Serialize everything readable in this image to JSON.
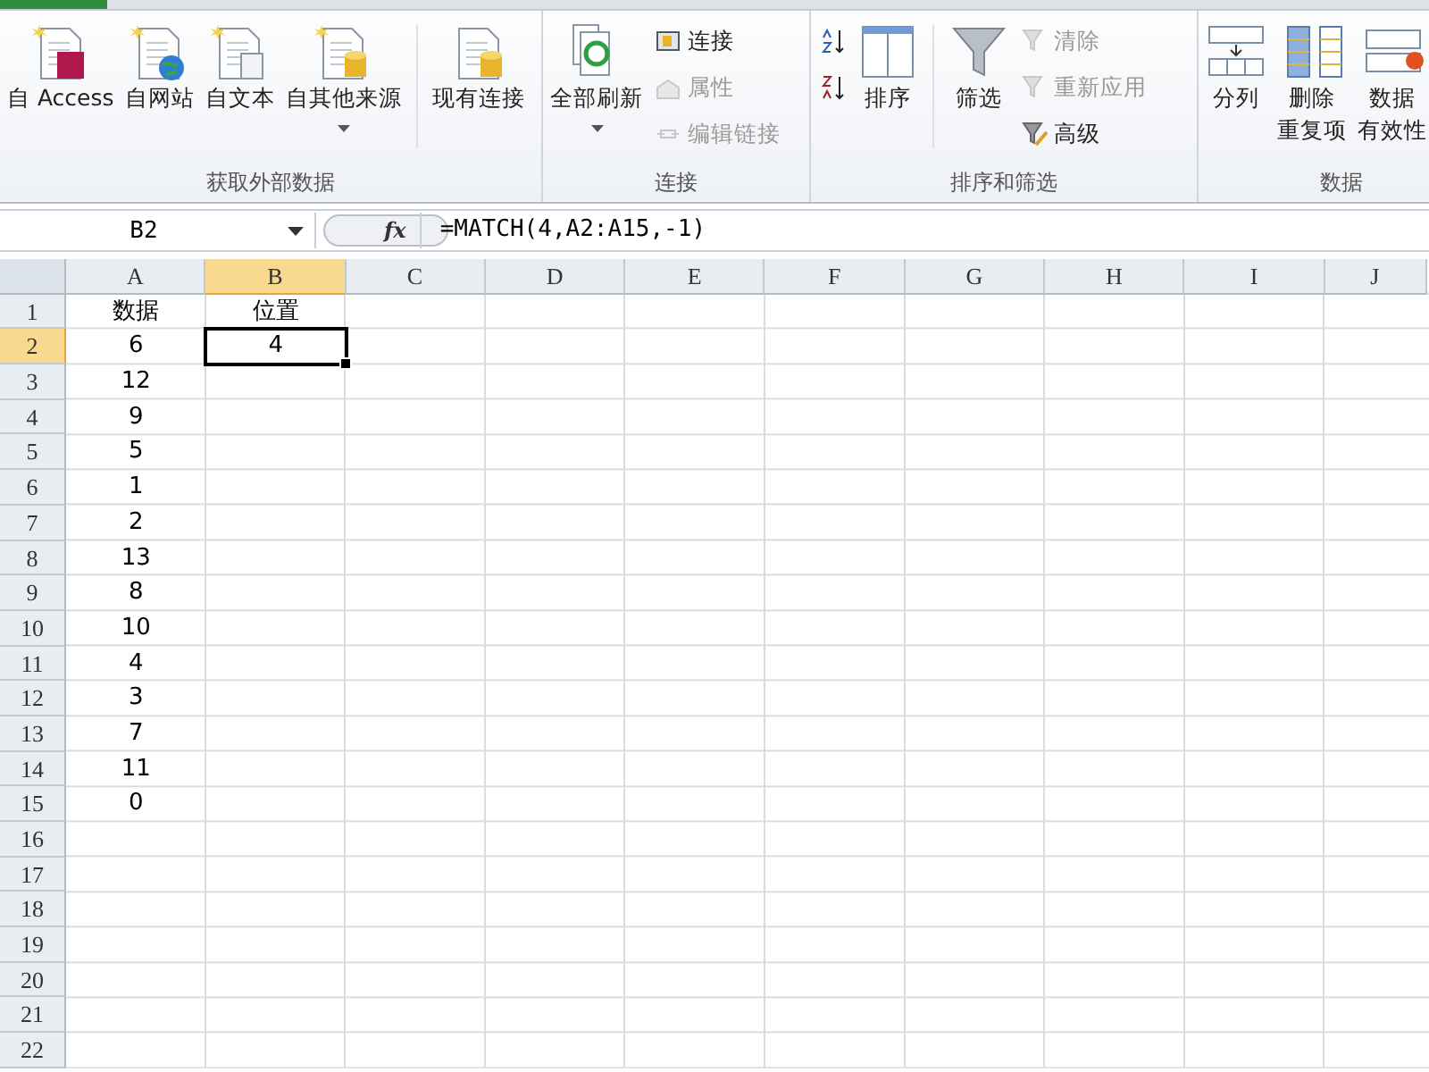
{
  "ribbon": {
    "groups": [
      {
        "label": "获取外部数据",
        "controls": [
          {
            "kind": "large",
            "label": "自 Access",
            "dropdown": false
          },
          {
            "kind": "large",
            "label": "自网站",
            "dropdown": false
          },
          {
            "kind": "large",
            "label": "自文本",
            "dropdown": false
          },
          {
            "kind": "large",
            "label": "自其他来源",
            "dropdown": true
          },
          {
            "kind": "separator"
          },
          {
            "kind": "large",
            "label": "现有连接",
            "dropdown": false
          }
        ]
      },
      {
        "label": "连接",
        "controls": [
          {
            "kind": "large",
            "label": "全部刷新",
            "dropdown": true
          },
          {
            "kind": "stack",
            "items": [
              {
                "label": "连接",
                "disabled": false
              },
              {
                "label": "属性",
                "disabled": true
              },
              {
                "label": "编辑链接",
                "disabled": true
              }
            ]
          }
        ]
      },
      {
        "label": "排序和筛选",
        "controls": [
          {
            "kind": "stack",
            "items": [
              {
                "disabled": false
              },
              {
                "disabled": false
              }
            ]
          },
          {
            "kind": "large",
            "label": "排序",
            "dropdown": false
          },
          {
            "kind": "separator"
          },
          {
            "kind": "large",
            "label": "筛选",
            "dropdown": false
          },
          {
            "kind": "stack",
            "items": [
              {
                "label": "清除",
                "disabled": true
              },
              {
                "label": "重新应用",
                "disabled": true
              },
              {
                "label": "高级",
                "disabled": false
              }
            ]
          }
        ]
      },
      {
        "label": "数据",
        "controls": [
          {
            "kind": "large",
            "label": "分列",
            "dropdown": false
          },
          {
            "kind": "large",
            "lines": [
              "删除",
              "重复项"
            ],
            "dropdown": false
          },
          {
            "kind": "large",
            "lines": [
              "数据",
              "有效性"
            ],
            "dropdown": false
          }
        ]
      }
    ]
  },
  "formula_bar": {
    "name_box": "B2",
    "fx": "fx",
    "formula": "=MATCH(4,A2:A15,-1)"
  },
  "sheet": {
    "columns": [
      {
        "label": "A",
        "selected": false
      },
      {
        "label": "B",
        "selected": true
      },
      {
        "label": "C",
        "selected": false
      },
      {
        "label": "D",
        "selected": false
      },
      {
        "label": "E",
        "selected": false
      },
      {
        "label": "F",
        "selected": false
      },
      {
        "label": "G",
        "selected": false
      },
      {
        "label": "H",
        "selected": false
      },
      {
        "label": "I",
        "selected": false
      },
      {
        "label": "J",
        "selected": false
      }
    ],
    "rows": [
      {
        "header": "1",
        "selected": false,
        "cells": [
          {
            "text": "数据",
            "active": false
          },
          {
            "text": "位置",
            "active": false
          }
        ]
      },
      {
        "header": "2",
        "selected": true,
        "cells": [
          {
            "text": "6",
            "active": false
          },
          {
            "text": "4",
            "active": true
          }
        ]
      },
      {
        "header": "3",
        "selected": false,
        "cells": [
          {
            "text": "12",
            "active": false
          }
        ]
      },
      {
        "header": "4",
        "selected": false,
        "cells": [
          {
            "text": "9",
            "active": false
          }
        ]
      },
      {
        "header": "5",
        "selected": false,
        "cells": [
          {
            "text": "5",
            "active": false
          }
        ]
      },
      {
        "header": "6",
        "selected": false,
        "cells": [
          {
            "text": "1",
            "active": false
          }
        ]
      },
      {
        "header": "7",
        "selected": false,
        "cells": [
          {
            "text": "2",
            "active": false
          }
        ]
      },
      {
        "header": "8",
        "selected": false,
        "cells": [
          {
            "text": "13",
            "active": false
          }
        ]
      },
      {
        "header": "9",
        "selected": false,
        "cells": [
          {
            "text": "8",
            "active": false
          }
        ]
      },
      {
        "header": "10",
        "selected": false,
        "cells": [
          {
            "text": "10",
            "active": false
          }
        ]
      },
      {
        "header": "11",
        "selected": false,
        "cells": [
          {
            "text": "4",
            "active": false
          }
        ]
      },
      {
        "header": "12",
        "selected": false,
        "cells": [
          {
            "text": "3",
            "active": false
          }
        ]
      },
      {
        "header": "13",
        "selected": false,
        "cells": [
          {
            "text": "7",
            "active": false
          }
        ]
      },
      {
        "header": "14",
        "selected": false,
        "cells": [
          {
            "text": "11",
            "active": false
          }
        ]
      },
      {
        "header": "15",
        "selected": false,
        "cells": [
          {
            "text": "0",
            "active": false
          }
        ]
      },
      {
        "header": "16",
        "selected": false
      },
      {
        "header": "17",
        "selected": false
      },
      {
        "header": "18",
        "selected": false
      },
      {
        "header": "19",
        "selected": false
      },
      {
        "header": "20",
        "selected": false
      },
      {
        "header": "21",
        "selected": false
      },
      {
        "header": "22",
        "selected": false
      }
    ]
  }
}
